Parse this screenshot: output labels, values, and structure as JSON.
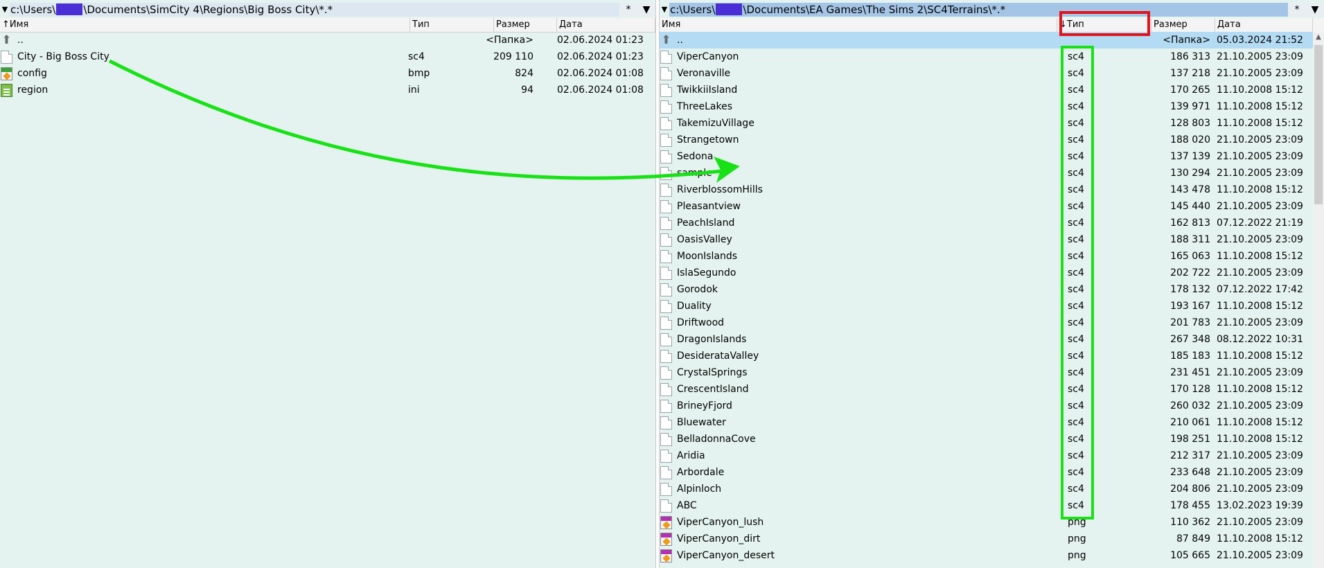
{
  "left": {
    "path_prefix": "c:\\Users\\",
    "path_suffix": "\\Documents\\SimCity 4\\Regions\\Big Boss City\\*.*",
    "star": "*",
    "drop": "▼",
    "headers": {
      "name": "↑Имя",
      "type": "Тип",
      "size": "Размер",
      "date": "Дата"
    },
    "rows": [
      {
        "icon": "up-folder-icon",
        "name": "..",
        "type": "",
        "size": "<Папка>",
        "date": "02.06.2024 01:23"
      },
      {
        "icon": "file-icon",
        "name": "City - Big Boss City",
        "type": "sc4",
        "size": "209 110",
        "date": "02.06.2024 01:23"
      },
      {
        "icon": "bmp-image-icon",
        "name": "config",
        "type": "bmp",
        "size": "824",
        "date": "02.06.2024 01:08"
      },
      {
        "icon": "ini-file-icon",
        "name": "region",
        "type": "ini",
        "size": "94",
        "date": "02.06.2024 01:08"
      }
    ]
  },
  "right": {
    "path_prefix": "c:\\Users\\",
    "path_suffix": "\\Documents\\EA Games\\The Sims 2\\SC4Terrains\\*.*",
    "star": "*",
    "drop": "▼",
    "headers": {
      "name": "Имя",
      "type": "↓Тип",
      "size": "Размер",
      "date": "Дата"
    },
    "rows": [
      {
        "icon": "up-folder-icon",
        "name": "..",
        "type": "",
        "size": "<Папка>",
        "date": "05.03.2024 21:52"
      },
      {
        "icon": "file-icon",
        "name": "ViperCanyon",
        "type": "sc4",
        "size": "186 313",
        "date": "21.10.2005 23:09"
      },
      {
        "icon": "file-icon",
        "name": "Veronaville",
        "type": "sc4",
        "size": "137 218",
        "date": "21.10.2005 23:09"
      },
      {
        "icon": "file-icon",
        "name": "TwikkiiIsland",
        "type": "sc4",
        "size": "170 265",
        "date": "11.10.2008 15:12"
      },
      {
        "icon": "file-icon",
        "name": "ThreeLakes",
        "type": "sc4",
        "size": "139 971",
        "date": "11.10.2008 15:12"
      },
      {
        "icon": "file-icon",
        "name": "TakemizuVillage",
        "type": "sc4",
        "size": "128 803",
        "date": "11.10.2008 15:12"
      },
      {
        "icon": "file-icon",
        "name": "Strangetown",
        "type": "sc4",
        "size": "188 020",
        "date": "21.10.2005 23:09"
      },
      {
        "icon": "file-icon",
        "name": "Sedona",
        "type": "sc4",
        "size": "137 139",
        "date": "21.10.2005 23:09"
      },
      {
        "icon": "file-icon",
        "name": "sample",
        "type": "sc4",
        "size": "130 294",
        "date": "21.10.2005 23:09"
      },
      {
        "icon": "file-icon",
        "name": "RiverblossomHills",
        "type": "sc4",
        "size": "143 478",
        "date": "11.10.2008 15:12"
      },
      {
        "icon": "file-icon",
        "name": "Pleasantview",
        "type": "sc4",
        "size": "145 440",
        "date": "21.10.2005 23:09"
      },
      {
        "icon": "file-icon",
        "name": "PeachIsland",
        "type": "sc4",
        "size": "162 813",
        "date": "07.12.2022 21:19"
      },
      {
        "icon": "file-icon",
        "name": "OasisValley",
        "type": "sc4",
        "size": "188 311",
        "date": "21.10.2005 23:09"
      },
      {
        "icon": "file-icon",
        "name": "MoonIslands",
        "type": "sc4",
        "size": "165 063",
        "date": "11.10.2008 15:12"
      },
      {
        "icon": "file-icon",
        "name": "IslaSegundo",
        "type": "sc4",
        "size": "202 722",
        "date": "21.10.2005 23:09"
      },
      {
        "icon": "file-icon",
        "name": "Gorodok",
        "type": "sc4",
        "size": "178 132",
        "date": "07.12.2022 17:42"
      },
      {
        "icon": "file-icon",
        "name": "Duality",
        "type": "sc4",
        "size": "193 167",
        "date": "11.10.2008 15:12"
      },
      {
        "icon": "file-icon",
        "name": "Driftwood",
        "type": "sc4",
        "size": "201 783",
        "date": "21.10.2005 23:09"
      },
      {
        "icon": "file-icon",
        "name": "DragonIslands",
        "type": "sc4",
        "size": "267 348",
        "date": "08.12.2022 10:31"
      },
      {
        "icon": "file-icon",
        "name": "DesiderataValley",
        "type": "sc4",
        "size": "185 183",
        "date": "11.10.2008 15:12"
      },
      {
        "icon": "file-icon",
        "name": "CrystalSprings",
        "type": "sc4",
        "size": "231 451",
        "date": "21.10.2005 23:09"
      },
      {
        "icon": "file-icon",
        "name": "CrescentIsland",
        "type": "sc4",
        "size": "170 128",
        "date": "11.10.2008 15:12"
      },
      {
        "icon": "file-icon",
        "name": "BrineyFjord",
        "type": "sc4",
        "size": "260 032",
        "date": "21.10.2005 23:09"
      },
      {
        "icon": "file-icon",
        "name": "Bluewater",
        "type": "sc4",
        "size": "210 061",
        "date": "11.10.2008 15:12"
      },
      {
        "icon": "file-icon",
        "name": "BelladonnaCove",
        "type": "sc4",
        "size": "198 251",
        "date": "11.10.2008 15:12"
      },
      {
        "icon": "file-icon",
        "name": "Aridia",
        "type": "sc4",
        "size": "212 317",
        "date": "21.10.2005 23:09"
      },
      {
        "icon": "file-icon",
        "name": "Arbordale",
        "type": "sc4",
        "size": "233 648",
        "date": "21.10.2005 23:09"
      },
      {
        "icon": "file-icon",
        "name": "Alpinloch",
        "type": "sc4",
        "size": "204 806",
        "date": "21.10.2005 23:09"
      },
      {
        "icon": "file-icon",
        "name": "ABC",
        "type": "sc4",
        "size": "178 455",
        "date": "13.02.2023 19:39"
      },
      {
        "icon": "png-image-icon",
        "name": "ViperCanyon_lush",
        "type": "png",
        "size": "110 362",
        "date": "21.10.2005 23:09"
      },
      {
        "icon": "png-image-icon",
        "name": "ViperCanyon_dirt",
        "type": "png",
        "size": "87 849",
        "date": "11.10.2008 15:12"
      },
      {
        "icon": "png-image-icon",
        "name": "ViperCanyon_desert",
        "type": "png",
        "size": "105 665",
        "date": "21.10.2005 23:09"
      }
    ]
  },
  "annotation_colors": {
    "red": "#e2131b",
    "green": "#18e216",
    "selection": "#b4dbf4",
    "panel": "#e4f3ef"
  }
}
